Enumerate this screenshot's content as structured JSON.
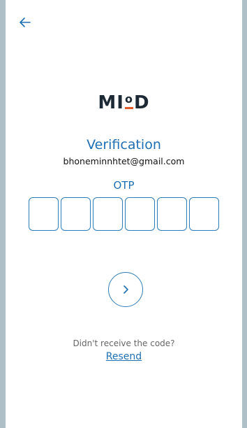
{
  "header": {
    "back_icon": "arrow-left-icon"
  },
  "brand": {
    "logo_text_left": "MI",
    "logo_text_o": "o",
    "logo_text_right": "D"
  },
  "main": {
    "title": "Verification",
    "email": "bhoneminnhtet@gmail.com",
    "otp_label": "OTP",
    "otp_digits": [
      "",
      "",
      "",
      "",
      "",
      ""
    ],
    "submit_icon": "chevron-right-icon",
    "no_code_text": "Didn't receive the code?",
    "resend_label": "Resend"
  },
  "colors": {
    "accent": "#1f6fb3",
    "border": "#2f7db8",
    "logo": "#1d2a36",
    "logo_underline": "#e25a2c"
  }
}
